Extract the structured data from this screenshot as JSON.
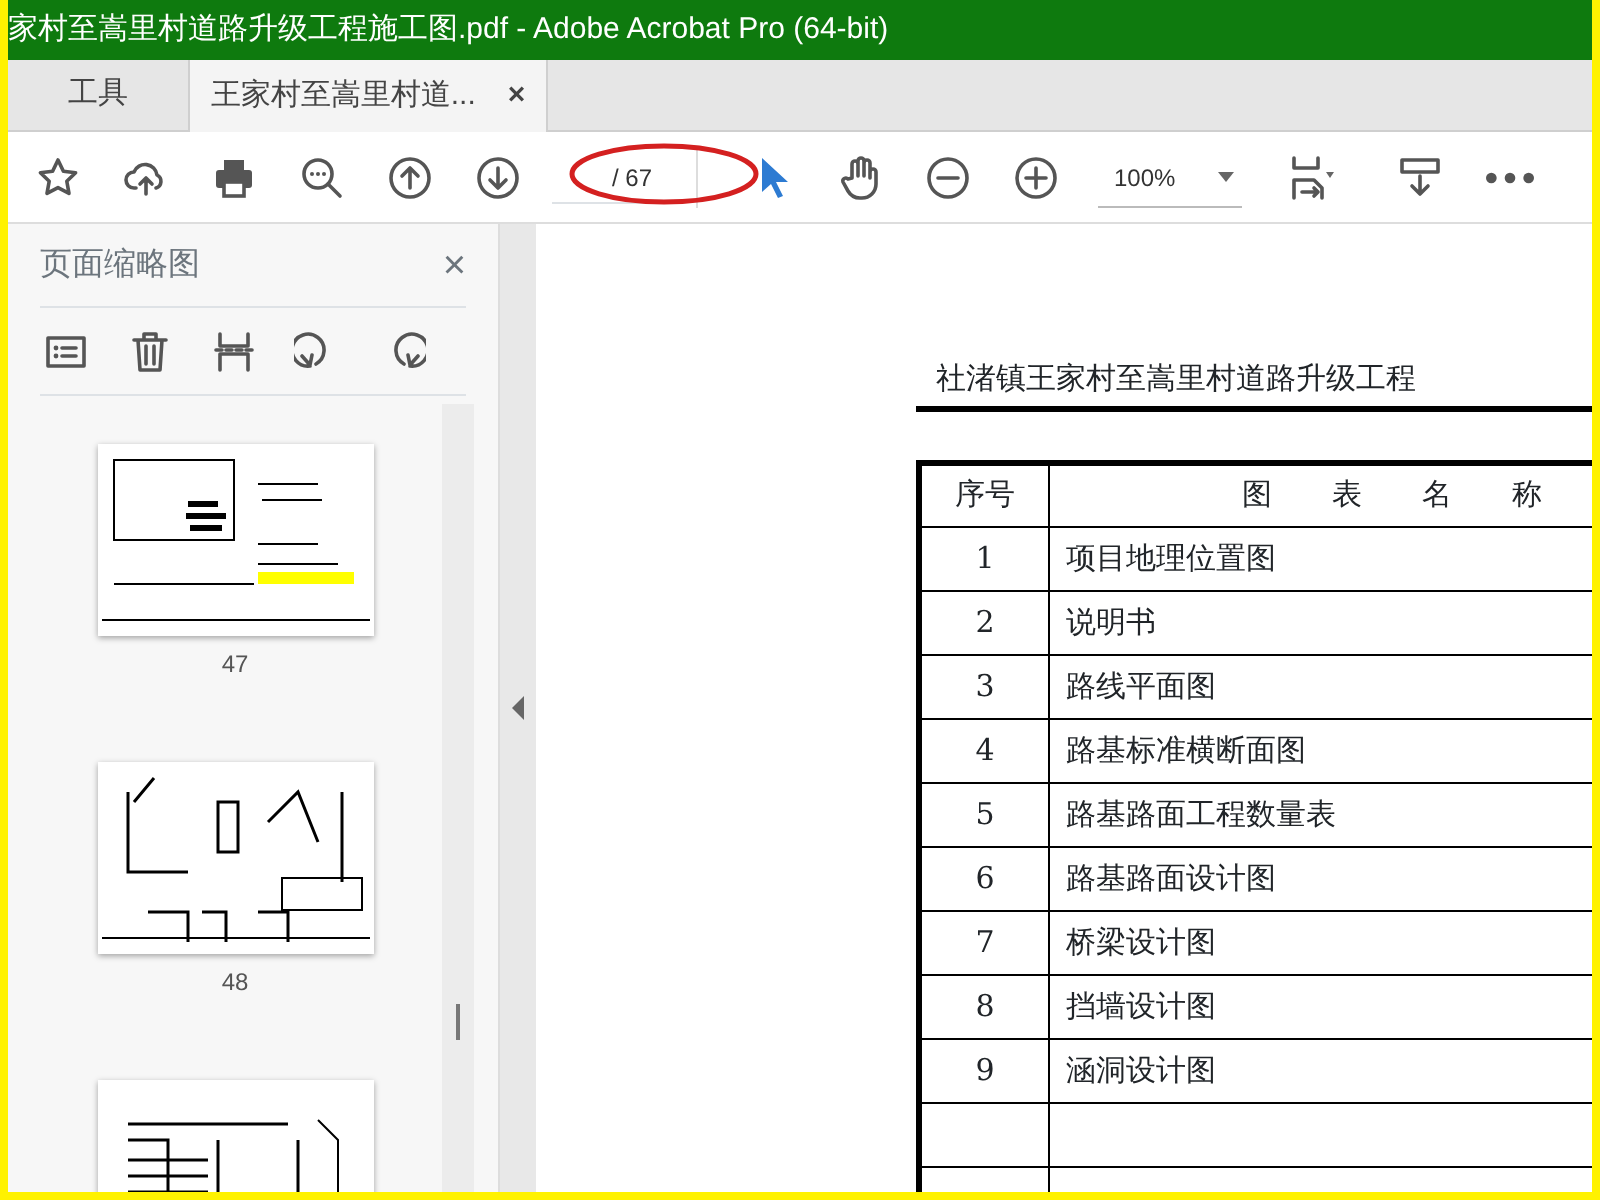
{
  "window": {
    "title": "家村至嵩里村道路升级工程施工图.pdf - Adobe Acrobat Pro (64-bit)"
  },
  "tabs": [
    {
      "label": "工具",
      "selected": false
    },
    {
      "label": "王家村至嵩里村道...",
      "selected": true,
      "close": "×"
    }
  ],
  "toolbar": {
    "page_total": "/ 67",
    "zoom": "100%"
  },
  "sidebar": {
    "title": "页面缩略图",
    "close": "×",
    "thumbnails": [
      {
        "label": "47",
        "kind": "map"
      },
      {
        "label": "48",
        "kind": "detail"
      },
      {
        "kind": "table"
      }
    ]
  },
  "document": {
    "heading": "社渚镇王家村至嵩里村道路升级工程",
    "table": {
      "columns": [
        "序号",
        "图　　表　　名　　称"
      ],
      "rows": [
        [
          "1",
          "项目地理位置图"
        ],
        [
          "2",
          "说明书"
        ],
        [
          "3",
          "路线平面图"
        ],
        [
          "4",
          "路基标准横断面图"
        ],
        [
          "5",
          "路基路面工程数量表"
        ],
        [
          "6",
          "路基路面设计图"
        ],
        [
          "7",
          "桥梁设计图"
        ],
        [
          "8",
          "挡墙设计图"
        ],
        [
          "9",
          "涵洞设计图"
        ]
      ]
    }
  }
}
